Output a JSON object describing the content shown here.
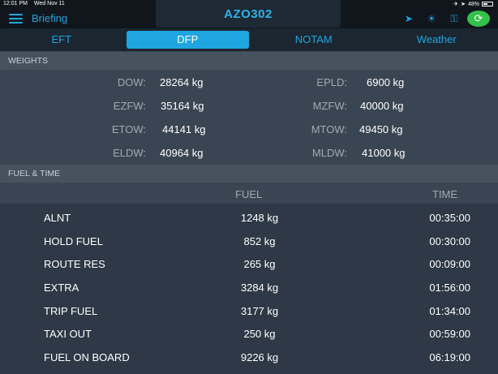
{
  "status_bar": {
    "time": "12:01 PM",
    "date": "Wed Nov 11",
    "battery": "48%"
  },
  "nav": {
    "back_label": "Briefing",
    "flight": "AZO302"
  },
  "tabs": [
    {
      "label": "EFT",
      "active": false
    },
    {
      "label": "DFP",
      "active": true
    },
    {
      "label": "NOTAM",
      "active": false
    },
    {
      "label": "Weather",
      "active": false
    }
  ],
  "weights": {
    "header": "WEIGHTS",
    "rows": [
      {
        "left_label": "DOW:",
        "left_value": "28264 kg",
        "right_label": "EPLD:",
        "right_value": "6900 kg"
      },
      {
        "left_label": "EZFW:",
        "left_value": "35164 kg",
        "right_label": "MZFW:",
        "right_value": "40000 kg"
      },
      {
        "left_label": "ETOW:",
        "left_value": "44141 kg",
        "right_label": "MTOW:",
        "right_value": "49450 kg"
      },
      {
        "left_label": "ELDW:",
        "left_value": "40964 kg",
        "right_label": "MLDW:",
        "right_value": "41000 kg"
      }
    ]
  },
  "fuel_time": {
    "header": "FUEL & TIME",
    "col_fuel": "FUEL",
    "col_time": "TIME",
    "rows": [
      {
        "name": "ALNT",
        "fuel": "1248 kg",
        "time": "00:35:00"
      },
      {
        "name": "HOLD FUEL",
        "fuel": "852 kg",
        "time": "00:30:00"
      },
      {
        "name": "ROUTE RES",
        "fuel": "265 kg",
        "time": "00:09:00"
      },
      {
        "name": "EXTRA",
        "fuel": "3284 kg",
        "time": "01:56:00"
      },
      {
        "name": "TRIP FUEL",
        "fuel": "3177 kg",
        "time": "01:34:00"
      },
      {
        "name": "TAXI OUT",
        "fuel": "250 kg",
        "time": "00:59:00"
      },
      {
        "name": "FUEL ON BOARD",
        "fuel": "9226 kg",
        "time": "06:19:00"
      }
    ]
  }
}
